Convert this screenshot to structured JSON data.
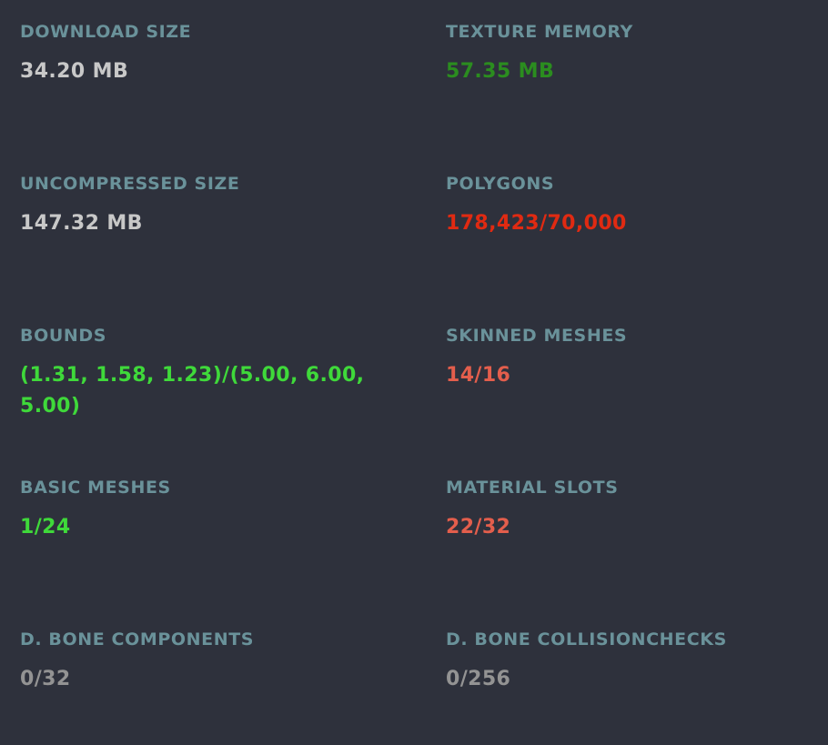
{
  "colors": {
    "background": "#2e313c",
    "label": "#6a929a",
    "neutral": "#c8c8c8",
    "good": "#3fd93a",
    "good_dim": "#2b8d1f",
    "bad": "#e02a12",
    "warn": "#e35e4c",
    "muted": "#939393"
  },
  "stats": {
    "download_size": {
      "label": "DOWNLOAD SIZE",
      "value": "34.20 MB",
      "status": "neutral"
    },
    "texture_memory": {
      "label": "TEXTURE MEMORY",
      "value": "57.35 MB",
      "status": "good_dim"
    },
    "uncompressed_size": {
      "label": "UNCOMPRESSED SIZE",
      "value": "147.32 MB",
      "status": "neutral"
    },
    "polygons": {
      "label": "POLYGONS",
      "value": "178,423/70,000",
      "status": "bad"
    },
    "bounds": {
      "label": "BOUNDS",
      "value": "(1.31, 1.58, 1.23)/(5.00, 6.00, 5.00)",
      "status": "good"
    },
    "skinned_meshes": {
      "label": "SKINNED MESHES",
      "value": "14/16",
      "status": "warn"
    },
    "basic_meshes": {
      "label": "BASIC MESHES",
      "value": "1/24",
      "status": "good"
    },
    "material_slots": {
      "label": "MATERIAL SLOTS",
      "value": "22/32",
      "status": "warn"
    },
    "dynamic_bone_components": {
      "label": "D. BONE COMPONENTS",
      "value": "0/32",
      "status": "muted"
    },
    "dynamic_bone_collision_checks": {
      "label": "D. BONE COLLISIONCHECKS",
      "value": "0/256",
      "status": "muted"
    }
  }
}
